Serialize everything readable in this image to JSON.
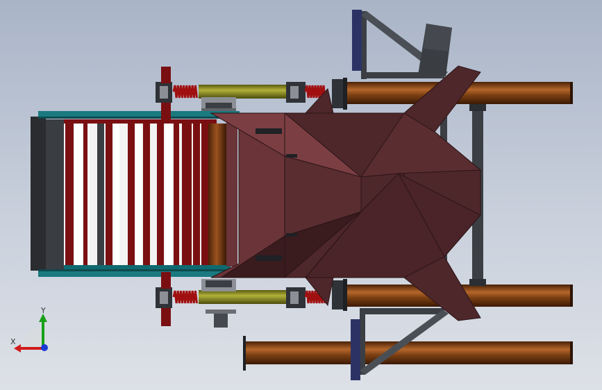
{
  "viewport": {
    "background_top": "#a9b4c7",
    "background_bottom": "#dde1e7"
  },
  "colors": {
    "hopper": "#4e272b",
    "hopper_light": "#6a3438",
    "hopper_edge": "#2a1416",
    "pipe": "#7a3f12",
    "pipe_highlight": "#b4662a",
    "frame_dark": "#3b3f44",
    "frame_mid": "#555a60",
    "bar_red": "#7a0f12",
    "rail_teal": "#1a7a80",
    "spring": "#a01010",
    "damper": "#8a8a1e",
    "pulley": "#8c9096",
    "flange": "#2c3364"
  },
  "triad": {
    "x_label": "X",
    "y_label": "Y",
    "x_color": "#d01b1b",
    "y_color": "#19a019",
    "z_color": "#1a3ad6"
  }
}
